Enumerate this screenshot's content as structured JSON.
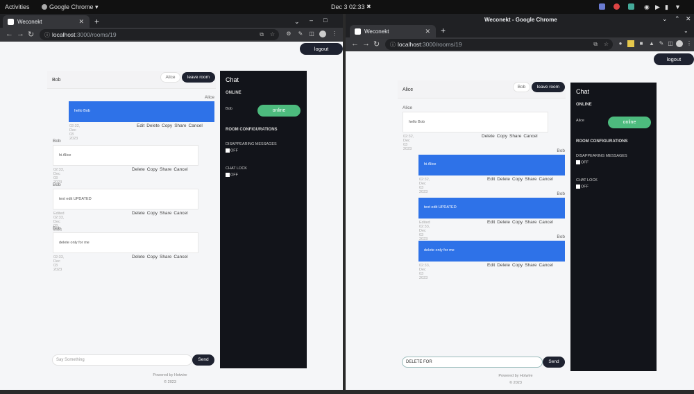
{
  "topbar": {
    "activities": "Activities",
    "app": "Google Chrome ▾",
    "clock": "Dec 3  02:33"
  },
  "right_window_title": "Weconekt - Google Chrome",
  "tab_title": "Weconekt",
  "url": {
    "host": "localhost",
    "path": ":3000/rooms/19"
  },
  "logout": "logout",
  "powered": "Powered by Hotwire",
  "copyright": "© 2023",
  "send": "Send",
  "leave_room": "leave room",
  "chat": {
    "title": "Chat",
    "online": "ONLINE",
    "room_config": "ROOM CONFIGURATIONS",
    "disappearing": "DISAPPEARING MESSAGES",
    "chat_lock": "CHAT LOCK",
    "off": "OFF",
    "online_btn": "online"
  },
  "action_words": {
    "edit": "Edit",
    "delete": "Delete",
    "copy": "Copy",
    "share": "Share",
    "cancel": "Cancel"
  },
  "left": {
    "room_user": "Bob",
    "other_user_btn": "Alice",
    "presence_user": "Bob",
    "input_placeholder": "Say Something",
    "messages": [
      {
        "sender": "Alice",
        "text": "hello Bob",
        "meta": "02:32, Dec 03 2023",
        "mine": true
      },
      {
        "sender": "Bob",
        "text": "hi Alice",
        "meta": "02:33, Dec 03 2023",
        "mine": false
      },
      {
        "sender": "Bob",
        "text": "text edit UPDATED",
        "meta": "Edited 02:33, Dec 03 2023",
        "mine": false
      },
      {
        "sender": "Bob",
        "text": "delete only for me",
        "meta": "02:33, Dec 03 2023",
        "mine": false
      }
    ]
  },
  "right": {
    "room_user": "Alice",
    "other_user_btn": "Bob",
    "presence_user": "Alice",
    "input_value": "DELETE FOR",
    "messages": [
      {
        "sender": "Alice",
        "text": "hello Bob",
        "meta": "02:32, Dec 03 2023",
        "mine": false
      },
      {
        "sender": "Bob",
        "text": "hi Alice",
        "meta": "02:32, Dec 03 2023",
        "mine": true
      },
      {
        "sender": "Bob",
        "text": "text edit UPDATED",
        "meta": "Edited 02:33, Dec 03 2023",
        "mine": true
      },
      {
        "sender": "Bob",
        "text": "delete only for me",
        "meta": "02:33, Dec 03 2023",
        "mine": true
      }
    ]
  }
}
